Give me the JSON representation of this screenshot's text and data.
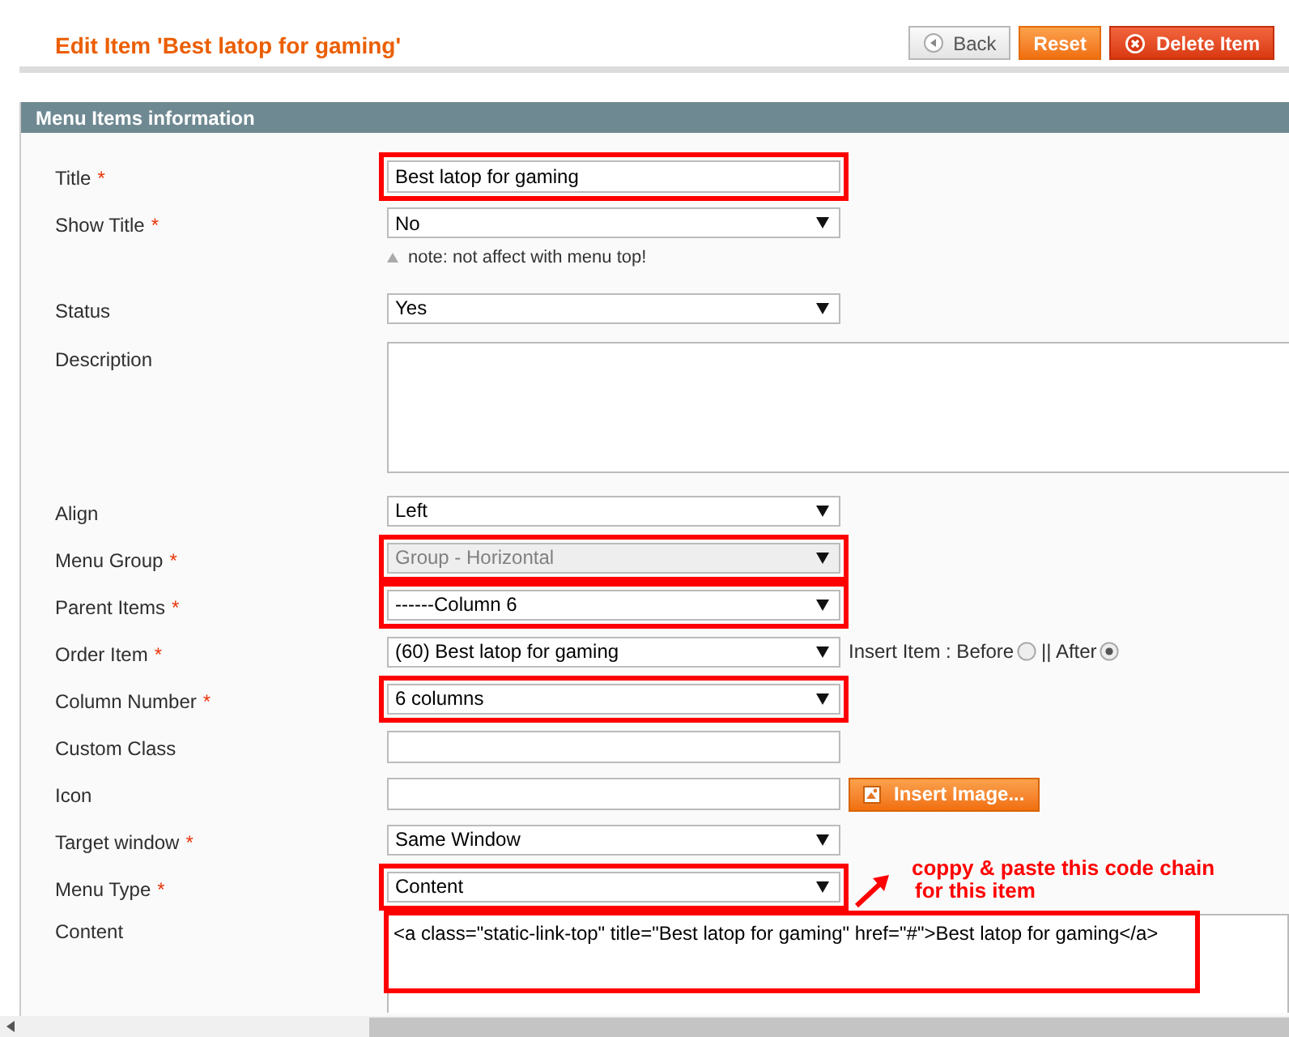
{
  "header": {
    "title": "Edit Item 'Best latop for gaming'",
    "buttons": [
      {
        "label": "Back",
        "kind": "back"
      },
      {
        "label": "Reset",
        "kind": "reset"
      },
      {
        "label": "Delete Item",
        "kind": "delete"
      }
    ]
  },
  "section": {
    "title": "Menu Items information"
  },
  "fields": [
    {
      "label": "Title",
      "mark": "*",
      "kind": "text",
      "value": "Best latop for gaming",
      "highlighted": true,
      "disabled": false
    },
    {
      "label": "Show Title",
      "mark": "*",
      "kind": "select",
      "value": "No",
      "highlighted": false,
      "disabled": false,
      "note": "note: not affect with menu top!"
    },
    {
      "label": "Status",
      "kind": "select",
      "value": "Yes",
      "highlighted": false,
      "disabled": false
    },
    {
      "label": "Description",
      "kind": "textarea",
      "highlighted": false,
      "disabled": false
    },
    {
      "label": "Align",
      "kind": "select",
      "value": "Left",
      "highlighted": false,
      "disabled": false
    },
    {
      "label": "Menu Group",
      "mark": "*",
      "kind": "select",
      "value": "Group - Horizontal",
      "highlighted": true,
      "disabled": true
    },
    {
      "label": "Parent Items",
      "mark": "*",
      "kind": "select",
      "value": "------Column 6",
      "highlighted": true,
      "disabled": false
    },
    {
      "label": "Order Item",
      "mark": "*",
      "kind": "select",
      "value": "(60) Best latop for gaming",
      "highlighted": false,
      "disabled": false,
      "radios": [
        {
          "label": "Insert Item : Before",
          "selected": false
        },
        {
          "label": "|| After",
          "selected": true
        }
      ]
    },
    {
      "label": "Column Number",
      "mark": "*",
      "kind": "select",
      "value": "6 columns",
      "highlighted": true,
      "disabled": false
    },
    {
      "label": "Custom Class",
      "kind": "text",
      "highlighted": false,
      "disabled": false
    },
    {
      "label": "Icon",
      "kind": "text",
      "highlighted": false,
      "disabled": false,
      "button": "Insert Image..."
    },
    {
      "label": "Target window",
      "mark": "*",
      "kind": "select",
      "value": "Same Window",
      "highlighted": false,
      "disabled": false
    },
    {
      "label": "Menu Type",
      "mark": "*",
      "kind": "select",
      "value": "Content",
      "highlighted": true,
      "disabled": false
    },
    {
      "label": "Content",
      "kind": "code",
      "value": "<a class=\"static-link-top\" title=\"Best latop for gaming\" href=\"#\">Best latop for gaming</a>",
      "highlighted": true,
      "disabled": false
    }
  ],
  "annotation": {
    "lines": [
      "coppy & paste this code chain",
      "for this item"
    ]
  }
}
